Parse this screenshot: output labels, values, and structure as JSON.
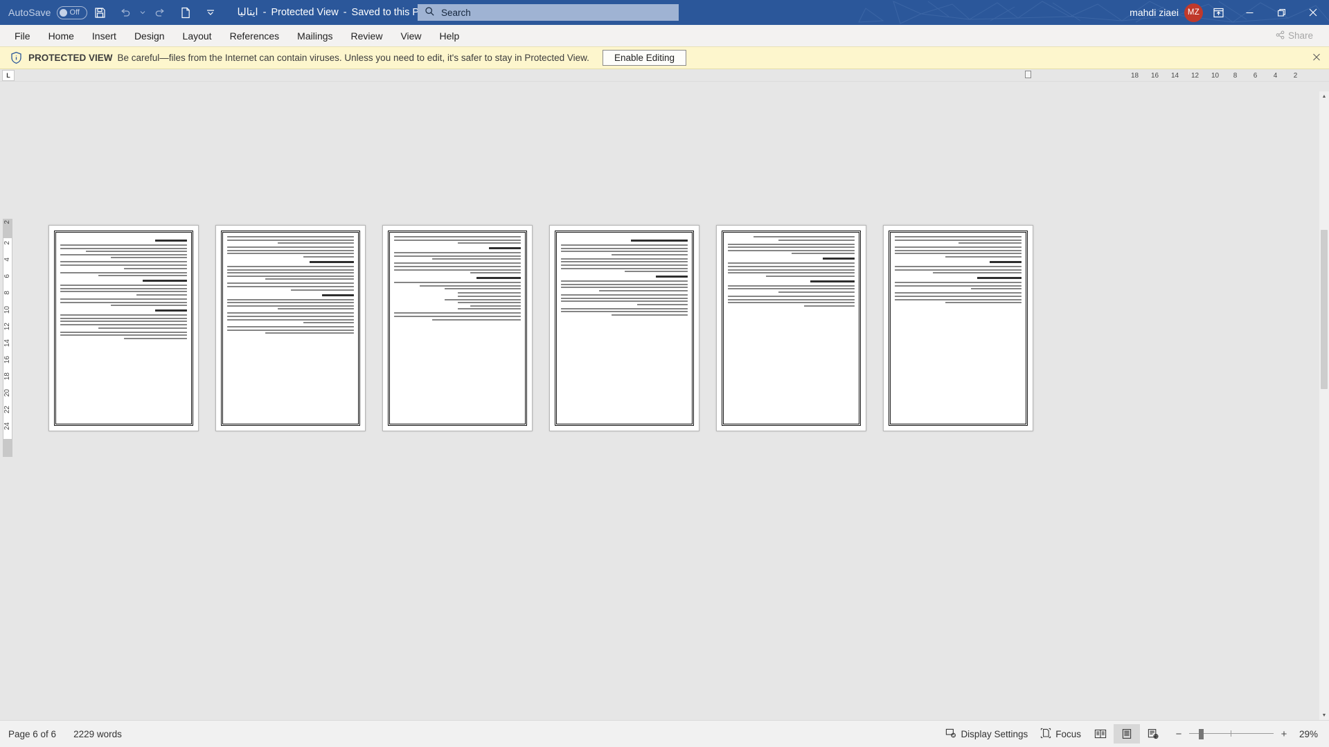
{
  "titlebar": {
    "autosave_label": "AutoSave",
    "autosave_state": "Off",
    "save_icon": "save-icon",
    "undo_icon": "undo-icon",
    "redo_icon": "redo-icon",
    "new_icon": "new-document-icon",
    "customize_icon": "customize-quick-access-toolbar-icon",
    "document_name": "ايتاليا",
    "separator1": "-",
    "view_mode": "Protected View",
    "separator2": "-",
    "save_location": "Saved to this PC",
    "dropdown_icon": "chevron-down-icon",
    "account_name": "mahdi ziaei",
    "account_initials": "MZ",
    "ribbon_display_icon": "ribbon-display-options-icon",
    "minimize_icon": "minimize-icon",
    "restore_icon": "restore-icon",
    "close_icon": "close-icon"
  },
  "search": {
    "icon": "search-icon",
    "placeholder": "Search"
  },
  "ribbon": {
    "tabs": [
      {
        "label": "File"
      },
      {
        "label": "Home"
      },
      {
        "label": "Insert"
      },
      {
        "label": "Design"
      },
      {
        "label": "Layout"
      },
      {
        "label": "References"
      },
      {
        "label": "Mailings"
      },
      {
        "label": "Review"
      },
      {
        "label": "View"
      },
      {
        "label": "Help"
      }
    ],
    "share_label": "Share",
    "share_icon": "share-icon"
  },
  "protected_view": {
    "icon": "shield-info-icon",
    "title": "PROTECTED VIEW",
    "message": "Be careful—files from the Internet can contain viruses. Unless you need to edit, it's safer to stay in Protected View.",
    "enable_button": "Enable Editing",
    "close_icon": "close-icon"
  },
  "ruler": {
    "corner_label": "L",
    "horizontal_ticks": [
      "18",
      "16",
      "14",
      "12",
      "10",
      "8",
      "6",
      "4",
      "2"
    ],
    "vertical_ticks": [
      "2",
      "2",
      "4",
      "6",
      "8",
      "10",
      "12",
      "14",
      "16",
      "18",
      "20",
      "22",
      "24"
    ]
  },
  "document": {
    "page_count": 6,
    "pages": [
      {
        "index": 1,
        "language": "fa",
        "direction": "rtl"
      },
      {
        "index": 2,
        "language": "fa",
        "direction": "rtl"
      },
      {
        "index": 3,
        "language": "fa",
        "direction": "rtl"
      },
      {
        "index": 4,
        "language": "fa",
        "direction": "rtl"
      },
      {
        "index": 5,
        "language": "fa",
        "direction": "rtl"
      },
      {
        "index": 6,
        "language": "fa",
        "direction": "rtl"
      }
    ]
  },
  "statusbar": {
    "page_indicator": "Page 6 of 6",
    "word_count": "2229 words",
    "display_settings_label": "Display Settings",
    "display_settings_icon": "display-settings-icon",
    "focus_label": "Focus",
    "focus_icon": "focus-icon",
    "view_read_icon": "read-mode-icon",
    "view_print_icon": "print-layout-icon",
    "view_web_icon": "web-layout-icon",
    "zoom_out_icon": "minus-icon",
    "zoom_in_icon": "plus-icon",
    "zoom_level": "29%"
  },
  "colors": {
    "titlebar_bg": "#2b579a",
    "ribbon_bg": "#f3f2f1",
    "protected_bar_bg": "#fdf6cd",
    "canvas_bg": "#e6e6e6",
    "avatar_bg": "#c0392b",
    "statusbar_bg": "#f1f1f1"
  }
}
